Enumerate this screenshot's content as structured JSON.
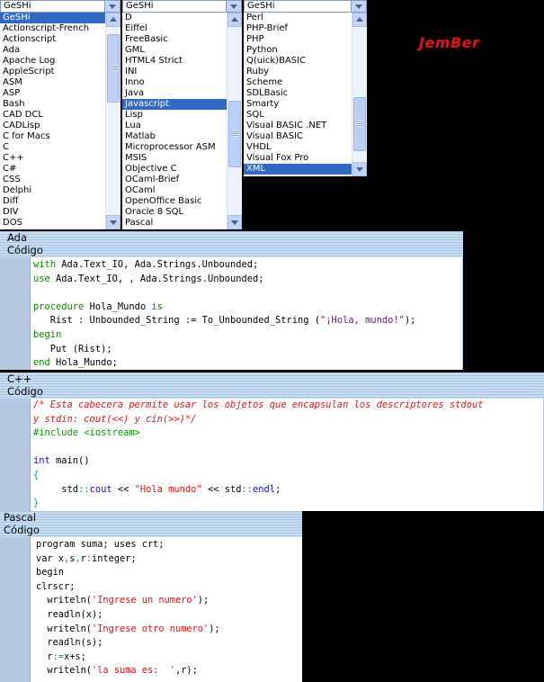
{
  "brand": {
    "logo_text": "JemBer"
  },
  "listboxes": [
    {
      "header": "GeSHi",
      "items": [
        "GeSHi",
        "Actionscript-French",
        "Actionscript",
        "Ada",
        "Apache Log",
        "AppleScript",
        "ASM",
        "ASP",
        "Bash",
        "CAD DCL",
        "CADLisp",
        "C for Macs",
        "C",
        "C++",
        "C#",
        "CSS",
        "Delphi",
        "Diff",
        "DIV",
        "DOS"
      ],
      "selected": "GeSHi"
    },
    {
      "header": "GeSHi",
      "items": [
        "D",
        "Eiffel",
        "FreeBasic",
        "GML",
        "HTML4 Strict",
        "INI",
        "Inno",
        "Java",
        "Javascript",
        "Lisp",
        "Lua",
        "Matlab",
        "Microprocessor ASM",
        "MSIS",
        "Objective C",
        "OCaml-Brief",
        "OCaml",
        "OpenOffice Basic",
        "Oracle 8 SQL",
        "Pascal"
      ],
      "selected": "Javascript"
    },
    {
      "header": "GeSHi",
      "items": [
        "Perl",
        "PHP-Brief",
        "PHP",
        "Python",
        "Q(uick)BASIC",
        "Ruby",
        "Scheme",
        "SDLBasic",
        "Smarty",
        "SQL",
        "Visual BASIC .NET",
        "Visual BASIC",
        "VHDL",
        "Visual Fox Pro",
        "XML"
      ],
      "selected": "XML"
    }
  ],
  "sections": [
    {
      "language": "Ada",
      "code_label": "Código",
      "lines": [
        [
          [
            "kw",
            "with"
          ],
          [
            "dark",
            " Ada.Text_IO, Ada.Strings.Unbounded;"
          ]
        ],
        [
          [
            "kw",
            "use"
          ],
          [
            "dark",
            " Ada.Text_IO, , Ada.Strings.Unbounded;"
          ]
        ],
        [
          [
            "dark",
            ""
          ]
        ],
        [
          [
            "kw",
            "procedure"
          ],
          [
            "dark",
            " Hola_Mundo "
          ],
          [
            "kw",
            "is"
          ]
        ],
        [
          [
            "dark",
            "   Rist : Unbounded_String := To_Unbounded_String ("
          ],
          [
            "str2",
            "\"¡Hola, mundo!\""
          ],
          [
            "dark",
            ");"
          ]
        ],
        [
          [
            "kw",
            "begin"
          ]
        ],
        [
          [
            "dark",
            "   Put (Rist);"
          ]
        ],
        [
          [
            "kw",
            "end"
          ],
          [
            "dark",
            " Hola_Mundo;"
          ]
        ]
      ]
    },
    {
      "language": "C++",
      "code_label": "Código",
      "lines": [
        [
          [
            "cm",
            "/* Esta cabecera permite usar los objetos que encapsulan los descriptores stdout"
          ]
        ],
        [
          [
            "cm",
            "y stdin: cout(<<) y cin(>>)*/"
          ]
        ],
        [
          [
            "pre",
            "#include <iostream>"
          ]
        ],
        [
          [
            "dark",
            ""
          ]
        ],
        [
          [
            "kw2",
            "int"
          ],
          [
            "dark",
            " main()"
          ]
        ],
        [
          [
            "op",
            "{"
          ]
        ],
        [
          [
            "dark",
            "     std"
          ],
          [
            "op",
            "::"
          ],
          [
            "kw2",
            "cout"
          ],
          [
            "dark",
            " << "
          ],
          [
            "str",
            "\"Hola mundo\""
          ],
          [
            "dark",
            " << std"
          ],
          [
            "op",
            "::"
          ],
          [
            "kw2",
            "endl"
          ],
          [
            "dark",
            ";"
          ]
        ],
        [
          [
            "op",
            "}"
          ]
        ]
      ]
    },
    {
      "language": "Pascal",
      "code_label": "Código",
      "lines": [
        [
          [
            "dark",
            "program suma; uses crt;"
          ]
        ],
        [
          [
            "dark",
            "var x"
          ],
          [
            "op",
            ","
          ],
          [
            "dark",
            "s"
          ],
          [
            "op",
            ","
          ],
          [
            "dark",
            "r"
          ],
          [
            "op",
            ":"
          ],
          [
            "dark",
            "integer;"
          ]
        ],
        [
          [
            "dark",
            "begin"
          ]
        ],
        [
          [
            "dark",
            "clrscr;"
          ]
        ],
        [
          [
            "dark",
            "  writeln("
          ],
          [
            "str",
            "'Ingrese un numero'"
          ],
          [
            "dark",
            ");"
          ]
        ],
        [
          [
            "dark",
            "  readln(x);"
          ]
        ],
        [
          [
            "dark",
            "  writeln("
          ],
          [
            "str",
            "'Ingrese otro numero'"
          ],
          [
            "dark",
            ");"
          ]
        ],
        [
          [
            "dark",
            "  readln(s);"
          ]
        ],
        [
          [
            "dark",
            "  r"
          ],
          [
            "op",
            ":="
          ],
          [
            "dark",
            "x+s;"
          ]
        ],
        [
          [
            "dark",
            "  writeln("
          ],
          [
            "str",
            "'la suma es:  '"
          ],
          [
            "dark",
            ",r);"
          ]
        ]
      ]
    }
  ]
}
